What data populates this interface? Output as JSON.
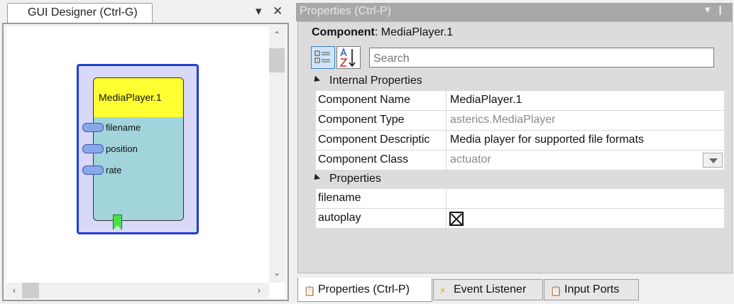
{
  "designer": {
    "tab_label": "GUI Designer (Ctrl-G)",
    "pin_glyph": "▾",
    "close_glyph": "✕",
    "component": {
      "title": "MediaPlayer.1",
      "ports": [
        "filename",
        "position",
        "rate"
      ]
    }
  },
  "properties": {
    "title": "Properties (Ctrl-P)",
    "component_label": "Component",
    "component_value": ": MediaPlayer.1",
    "search_placeholder": "Search",
    "categories": [
      {
        "label": "Internal Properties",
        "rows": [
          {
            "name": "Component Name",
            "value": "MediaPlayer.1",
            "readonly": false
          },
          {
            "name": "Component Type",
            "value": "asterics.MediaPlayer",
            "readonly": true
          },
          {
            "name": "Component Descriptic",
            "value": "Media player for supported file formats",
            "readonly": false
          },
          {
            "name": "Component Class",
            "value": "actuator",
            "readonly": true,
            "dropdown": true
          }
        ]
      },
      {
        "label": "Properties",
        "rows": [
          {
            "name": "filename",
            "value": "",
            "readonly": false
          },
          {
            "name": "autoplay",
            "value": "",
            "checkbox": true,
            "checked": true
          }
        ]
      }
    ]
  },
  "bottom_tabs": [
    {
      "label": "Properties (Ctrl-P)",
      "icon": "properties-icon",
      "active": true
    },
    {
      "label": "Event Listener",
      "icon": "lightning-icon",
      "active": false
    },
    {
      "label": "Input Ports",
      "icon": "ports-icon",
      "active": false
    }
  ],
  "colors": {
    "component_border": "#1f3fd0",
    "component_bg": "#d8d8f8",
    "title_box": "#ffff32",
    "body": "#a2d4dc",
    "port": "#8aa8e8",
    "event_marker": "#4ae24a"
  }
}
